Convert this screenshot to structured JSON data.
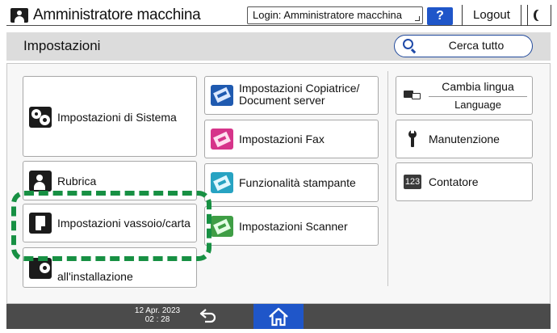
{
  "topbar": {
    "user_title": "Amministratore macchina",
    "login_label": "Login: Amministratore macchina",
    "help_label": "?",
    "logout_label": "Logout"
  },
  "header": {
    "title": "Impostazioni",
    "search_label": "Cerca tutto"
  },
  "tiles": {
    "system": "Impostazioni di Sistema",
    "rubrica": "Rubrica",
    "vassoio": "Impostazioni vassoio/carta",
    "installazione": "all'installazione",
    "copier_line1": "Impostazioni Copiatrice/",
    "copier_line2": "Document server",
    "fax": "Impostazioni Fax",
    "printer": "Funzionalità stampante",
    "scanner": "Impostazioni Scanner",
    "lang_line1": "Cambia lingua",
    "lang_line2": "Language",
    "maintenance": "Manutenzione",
    "counter": "Contatore",
    "counter_icon_text": "123"
  },
  "status": {
    "date": "12 Apr. 2023",
    "time": "02 : 28"
  },
  "colors": {
    "accent": "#1f56c9",
    "highlight": "#179043",
    "fax_icon": "#d6348a",
    "copier_icon": "#1f5ab0",
    "printer_icon": "#27a3c2",
    "scanner_icon": "#3f9e45"
  }
}
